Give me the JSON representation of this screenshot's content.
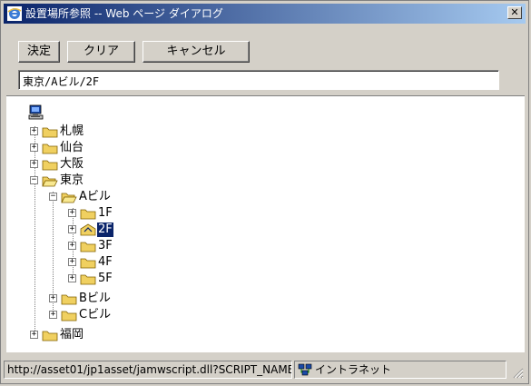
{
  "window": {
    "title": "設置場所参照 -- Web ページ ダイアログ",
    "close_label": "✕"
  },
  "toolbar": {
    "ok_label": "決定",
    "clear_label": "クリア",
    "cancel_label": "キャンセル"
  },
  "path_input": {
    "value": "東京/Aビル/2F"
  },
  "tree": {
    "root": {
      "label": "",
      "icon": "computer-icon"
    },
    "nodes": [
      {
        "id": "sapporo",
        "label": "札幌",
        "expander": "+",
        "icon": "folder-icon"
      },
      {
        "id": "sendai",
        "label": "仙台",
        "expander": "+",
        "icon": "folder-icon"
      },
      {
        "id": "osaka",
        "label": "大阪",
        "expander": "+",
        "icon": "folder-icon"
      },
      {
        "id": "tokyo",
        "label": "東京",
        "expander": "−",
        "icon": "folder-open-icon"
      },
      {
        "id": "a-bldg",
        "label": "Aビル",
        "expander": "−",
        "icon": "folder-open-icon"
      },
      {
        "id": "1f",
        "label": "1F",
        "expander": "+",
        "icon": "folder-icon"
      },
      {
        "id": "2f",
        "label": "2F",
        "expander": "+",
        "icon": "folder-selected-icon",
        "selected": true
      },
      {
        "id": "3f",
        "label": "3F",
        "expander": "+",
        "icon": "folder-icon"
      },
      {
        "id": "4f",
        "label": "4F",
        "expander": "+",
        "icon": "folder-icon"
      },
      {
        "id": "5f",
        "label": "5F",
        "expander": "+",
        "icon": "folder-icon"
      },
      {
        "id": "b-bldg",
        "label": "Bビル",
        "expander": "+",
        "icon": "folder-icon"
      },
      {
        "id": "c-bldg",
        "label": "Cビル",
        "expander": "+",
        "icon": "folder-icon"
      },
      {
        "id": "fukuoka",
        "label": "福岡",
        "expander": "+",
        "icon": "folder-icon"
      }
    ]
  },
  "statusbar": {
    "url": "http://asset01/jp1asset/jamwscript.dll?SCRIPT_NAME=",
    "zone": "イントラネット",
    "zone_icon": "intranet-icon"
  },
  "colors": {
    "title_start": "#0a246a",
    "title_end": "#a6caf0",
    "selection": "#0a246a",
    "folder": "#f0d060"
  }
}
